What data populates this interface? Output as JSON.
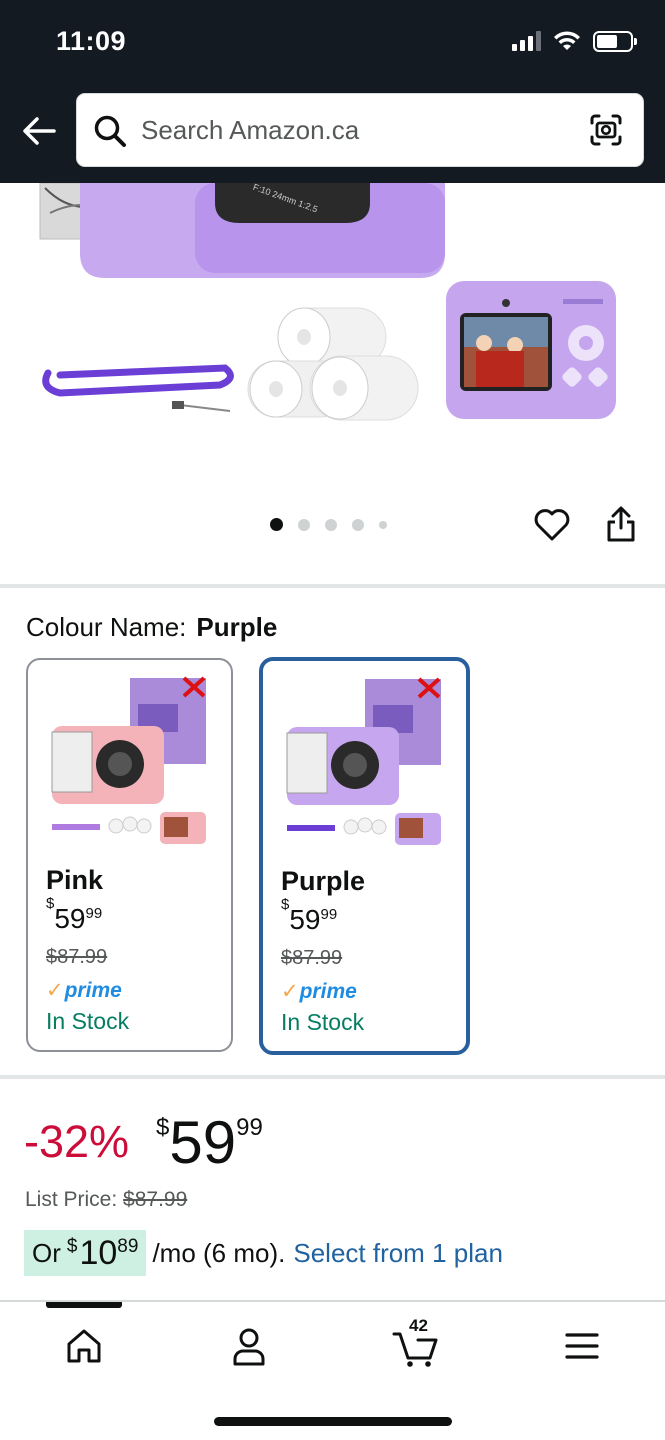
{
  "status_bar": {
    "time": "11:09"
  },
  "search": {
    "placeholder": "Search Amazon.ca"
  },
  "gallery": {
    "dot_count": 5,
    "active_index": 0
  },
  "colour": {
    "label": "Colour Name:",
    "selected": "Purple"
  },
  "swatches": [
    {
      "name": "Pink",
      "price_currency": "$",
      "price_dollars": "59",
      "price_cents": "99",
      "list_price": "$87.99",
      "prime": "prime",
      "stock": "In Stock",
      "colors": {
        "body": "#f4b3b9",
        "box": "#a98bd9"
      }
    },
    {
      "name": "Purple",
      "price_currency": "$",
      "price_dollars": "59",
      "price_cents": "99",
      "list_price": "$87.99",
      "prime": "prime",
      "stock": "In Stock",
      "colors": {
        "body": "#c6a6ee",
        "box": "#a98bd9"
      }
    }
  ],
  "price": {
    "discount": "-32%",
    "currency": "$",
    "dollars": "59",
    "cents": "99",
    "list_label": "List Price:",
    "list_value": "$87.99",
    "monthly_prefix": "Or",
    "monthly_currency": "$",
    "monthly_amount": "10",
    "monthly_cents": "89",
    "monthly_suffix": "/mo (6 mo).",
    "plan_link": "Select from 1 plan"
  },
  "nav": {
    "cart_count": "42"
  },
  "colors": {
    "header_bg": "#131a22",
    "deal_red": "#cc0c39",
    "link_blue": "#2162a1",
    "stock_green": "#067d62",
    "prime_blue": "#1f8ce2",
    "selected_border": "#2a5f9e"
  }
}
